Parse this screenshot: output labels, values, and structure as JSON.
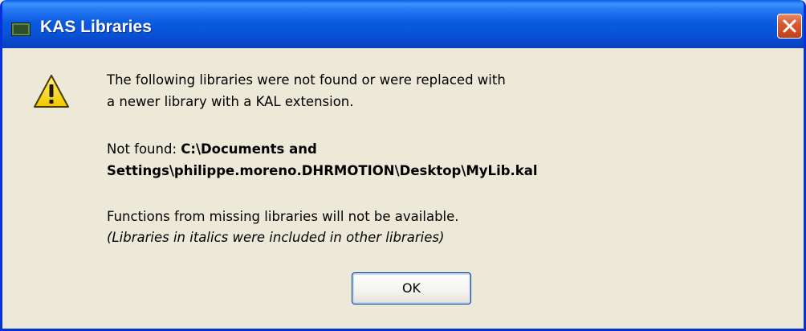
{
  "window": {
    "title": "KAS Libraries",
    "icon": "app-window-icon",
    "close_icon": "close-icon"
  },
  "message": {
    "icon": "warning-icon",
    "line1": "The following libraries were not found or were replaced with",
    "line2": "a newer library with a KAL extension.",
    "not_found_label": "Not found: ",
    "not_found_path_part1": "C:\\Documents and",
    "not_found_path_part2": "Settings\\philippe.moreno.DHRMOTION\\Desktop\\MyLib.kal",
    "functions_note": "Functions from missing libraries will not be available.",
    "italics_note": "(Libraries in italics were included in other libraries)"
  },
  "buttons": {
    "ok_label": "OK"
  },
  "colors": {
    "titlebar": "#0a5fe0",
    "dialog_background": "#ece9d8",
    "close_button": "#d85a33",
    "warning_yellow": "#ffd700"
  }
}
